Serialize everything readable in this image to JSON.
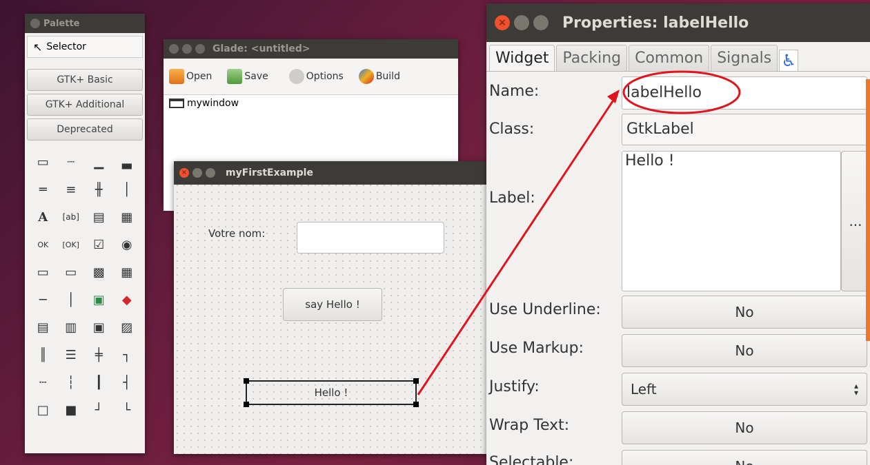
{
  "palette": {
    "title": "Palette",
    "selector_label": "Selector",
    "groups": [
      "GTK+ Basic",
      "GTK+ Additional",
      "Deprecated"
    ],
    "icons": [
      "window-icon",
      "toolbar-icon",
      "menubar-icon",
      "statusbar-icon",
      "hbox-icon",
      "vbox-icon",
      "grid-icon",
      "paned-icon",
      "label-icon",
      "entry-icon",
      "textview-icon",
      "combobox-icon",
      "button-icon",
      "togglebutton-icon",
      "checkbox-icon",
      "radio-icon",
      "spinbutton-icon",
      "switch-icon",
      "treeview-icon",
      "iconview-icon",
      "separator-icon",
      "vseparator-icon",
      "image-icon",
      "colorbutton-icon",
      "calendar-icon",
      "filechooser-icon",
      "fontbutton-icon",
      "linkbutton-icon",
      "vbox-layout-icon",
      "hbox-layout-icon",
      "table-layout-icon",
      "notebook-icon",
      "hscale-icon",
      "vscale-icon",
      "scrollbar-icon",
      "progress-icon",
      "frame-icon",
      "alignment-icon",
      "eventbox-icon",
      "expander-icon"
    ]
  },
  "glade": {
    "title": "Glade: <untitled>",
    "toolbar": {
      "open": "Open",
      "save": "Save",
      "options": "Options",
      "build": "Build"
    },
    "tree": [
      "mywindow"
    ]
  },
  "myfirst": {
    "title": "myFirstExample",
    "name_label": "Votre nom:",
    "name_value": "",
    "say_button": "say Hello !",
    "hello_label": "Hello !"
  },
  "props": {
    "title": "Properties: labelHello",
    "tabs": [
      "Widget",
      "Packing",
      "Common",
      "Signals"
    ],
    "name_label": "Name:",
    "name_value": "labelHello",
    "class_label": "Class:",
    "class_value": "GtkLabel",
    "label_label": "Label:",
    "label_value": "Hello !",
    "ellipsis": "...",
    "use_underline_label": "Use Underline:",
    "use_underline_value": "No",
    "use_markup_label": "Use Markup:",
    "use_markup_value": "No",
    "justify_label": "Justify:",
    "justify_value": "Left",
    "wrap_label": "Wrap Text:",
    "wrap_value": "No",
    "selectable_label": "Selectable:",
    "selectable_value": "No"
  },
  "annotation": {
    "color": "#e0141c"
  }
}
